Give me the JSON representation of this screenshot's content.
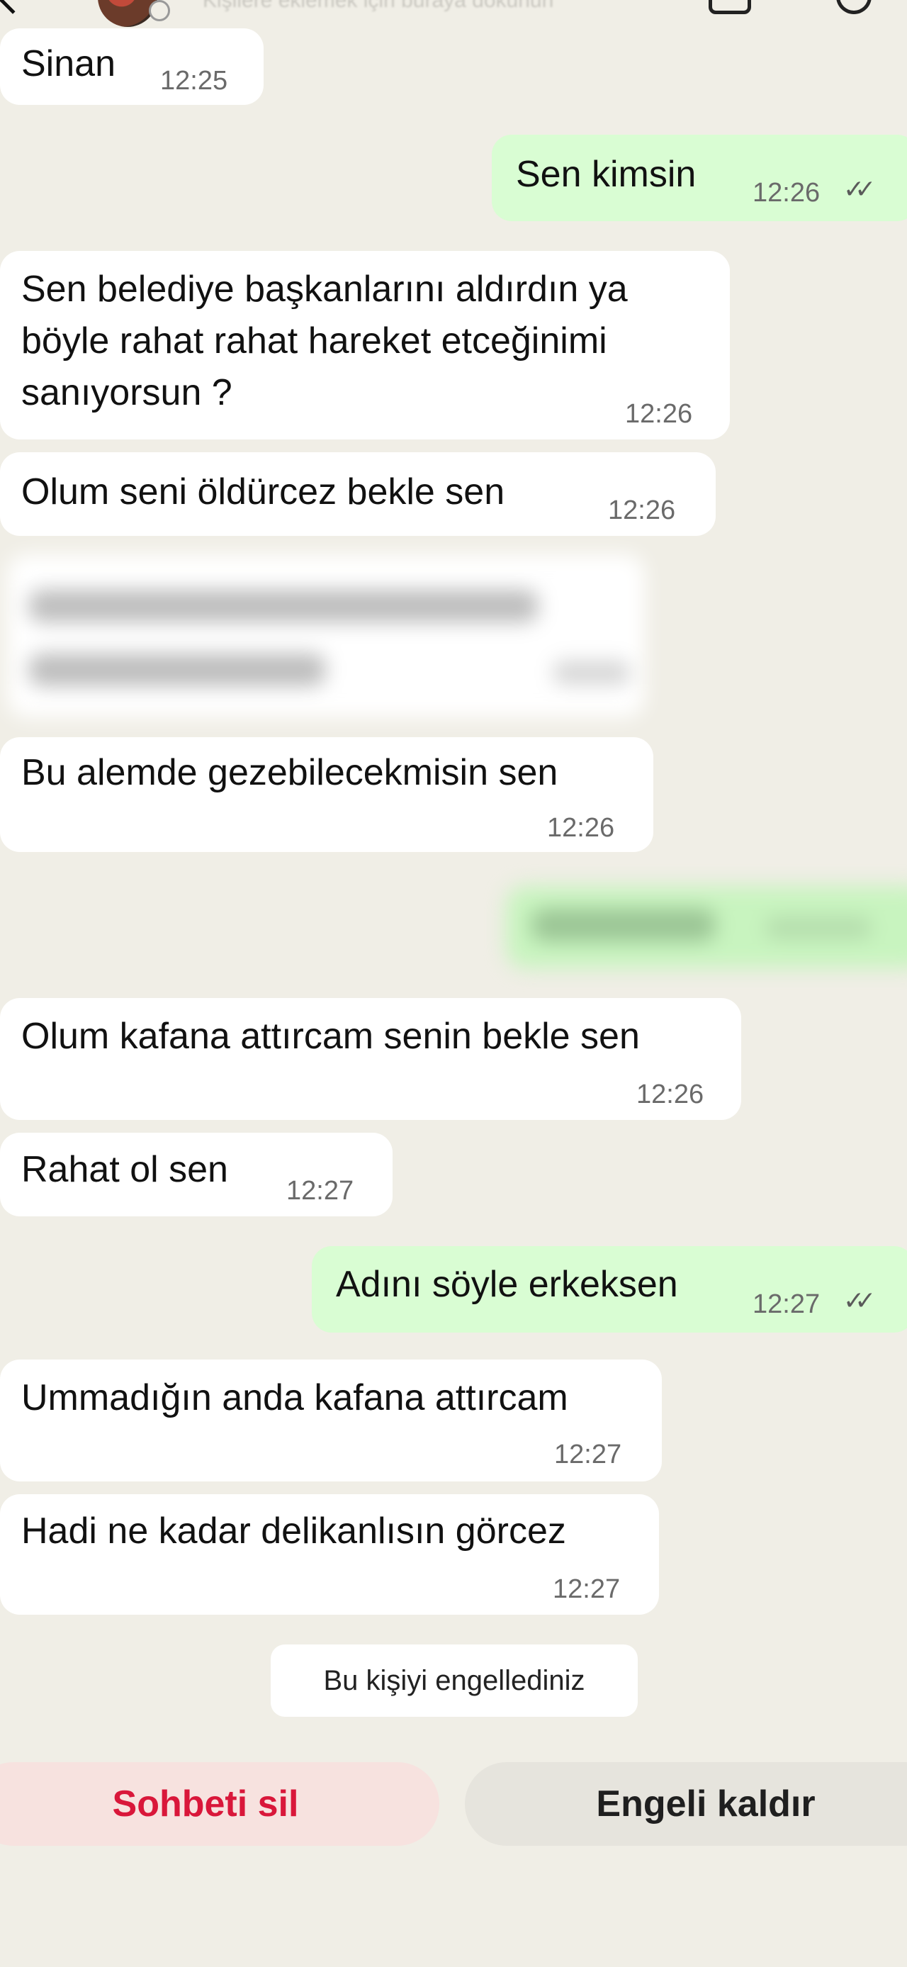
{
  "header": {
    "subtitle": "Kişilere eklemek için buraya dokunun",
    "back_icon": "chevron-left-icon",
    "timer_icon": "disappearing-timer-icon",
    "video_icon": "video-call-icon",
    "call_icon": "phone-icon"
  },
  "messages": [
    {
      "dir": "in",
      "lines": [
        "Sinan"
      ],
      "time": "12:25"
    },
    {
      "dir": "out",
      "lines": [
        "Sen kimsin"
      ],
      "time": "12:26",
      "ticks": "✓✓"
    },
    {
      "dir": "in",
      "lines": [
        "Sen belediye başkanlarını aldırdın ya",
        "böyle rahat rahat hareket etceğinimi",
        "sanıyorsun ?"
      ],
      "time": "12:26"
    },
    {
      "dir": "in",
      "lines": [
        "Olum seni öldürcez bekle sen"
      ],
      "time": "12:26"
    },
    {
      "dir": "in",
      "lines": [
        "Bu alemde gezebilecekmisin sen"
      ],
      "time": "12:26"
    },
    {
      "dir": "in",
      "lines": [
        "Olum kafana attırcam senin bekle sen"
      ],
      "time": "12:26"
    },
    {
      "dir": "in",
      "lines": [
        "Rahat ol sen"
      ],
      "time": "12:27"
    },
    {
      "dir": "out",
      "lines": [
        "Adını söyle erkeksen"
      ],
      "time": "12:27",
      "ticks": "✓✓"
    },
    {
      "dir": "in",
      "lines": [
        "Ummadığın anda kafana attırcam"
      ],
      "time": "12:27"
    },
    {
      "dir": "in",
      "lines": [
        "Hadi ne kadar delikanlısın görcez"
      ],
      "time": "12:27"
    }
  ],
  "system_note": "Bu kişiyi engellediniz",
  "actions": {
    "delete_chat": "Sohbeti sil",
    "unblock": "Engeli kaldır"
  },
  "colors": {
    "background": "#f0eee6",
    "incoming": "#ffffff",
    "outgoing": "#d9fdd3",
    "delete": "#d9173a"
  }
}
